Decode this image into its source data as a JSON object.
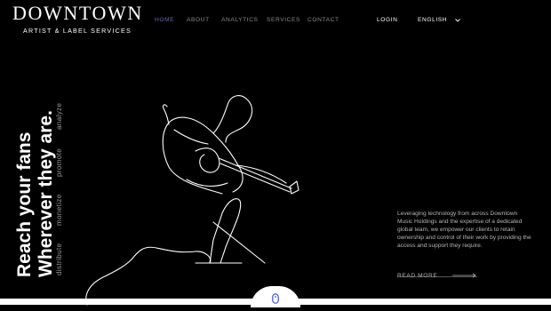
{
  "brand": {
    "name": "DOWNTOWN",
    "tagline": "ARTIST & LABEL SERVICES"
  },
  "nav": {
    "items": [
      {
        "label": "HOME",
        "active": true
      },
      {
        "label": "ABOUT"
      },
      {
        "label": "ANALYTICS"
      },
      {
        "label": "SERVICES"
      },
      {
        "label": "CONTACT"
      }
    ],
    "login": "LOGIN",
    "language": "ENGLISH"
  },
  "hero": {
    "line1": "Reach your fans",
    "line2": "Wherever they are.",
    "verbs": [
      "distribute",
      "monetize",
      "promote",
      "analyze"
    ]
  },
  "description": "Leveraging technology from across Downtown Music Holdings and the expertise of a dedicated global team, we empower our clients to retain ownership and control of their work by providing the access and support they require.",
  "cta": {
    "read_more": "READ MORE"
  },
  "colors": {
    "background": "#000000",
    "foreground": "#ffffff",
    "nav_active": "#5b6ea8",
    "muted": "#8a8a8a"
  },
  "icons": {
    "scroll": "mouse-scroll-icon",
    "arrow": "arrow-right-icon",
    "language": "chevron-down-icon"
  }
}
